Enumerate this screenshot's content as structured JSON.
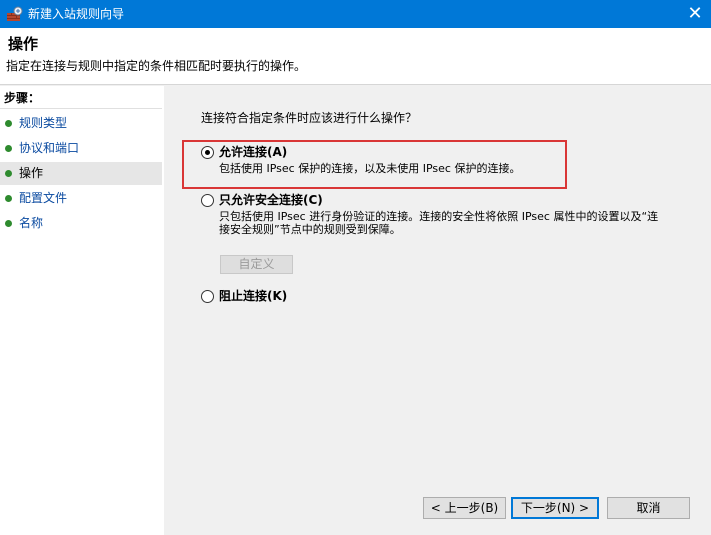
{
  "window": {
    "title": "新建入站规则向导",
    "close_glyph": "✕"
  },
  "header": {
    "title": "操作",
    "description": "指定在连接与规则中指定的条件相匹配时要执行的操作。"
  },
  "sidebar": {
    "title": "步骤：",
    "items": [
      {
        "label": "规则类型",
        "active": false
      },
      {
        "label": "协议和端口",
        "active": false
      },
      {
        "label": "操作",
        "active": true
      },
      {
        "label": "配置文件",
        "active": false
      },
      {
        "label": "名称",
        "active": false
      }
    ]
  },
  "main": {
    "question": "连接符合指定条件时应该进行什么操作？",
    "options": [
      {
        "title": "允许连接(A)",
        "description": "包括使用 IPsec 保护的连接，以及未使用 IPsec 保护的连接。",
        "checked": true
      },
      {
        "title": "只允许安全连接(C)",
        "description": "只包括使用 IPsec 进行身份验证的连接。连接的安全性将依照 IPsec 属性中的设置以及“连接安全规则”节点中的规则受到保障。",
        "checked": false
      },
      {
        "title": "阻止连接(K)",
        "description": "",
        "checked": false
      }
    ],
    "customize_label": "自定义"
  },
  "footer": {
    "back_label": "< 上一步(B)",
    "next_label": "下一步(N) >",
    "cancel_label": "取消"
  },
  "colors": {
    "titlebar": "#0078d7",
    "highlight": "#d93636",
    "step_dot": "#2e8b2e",
    "step_link": "#0a4aa0"
  }
}
